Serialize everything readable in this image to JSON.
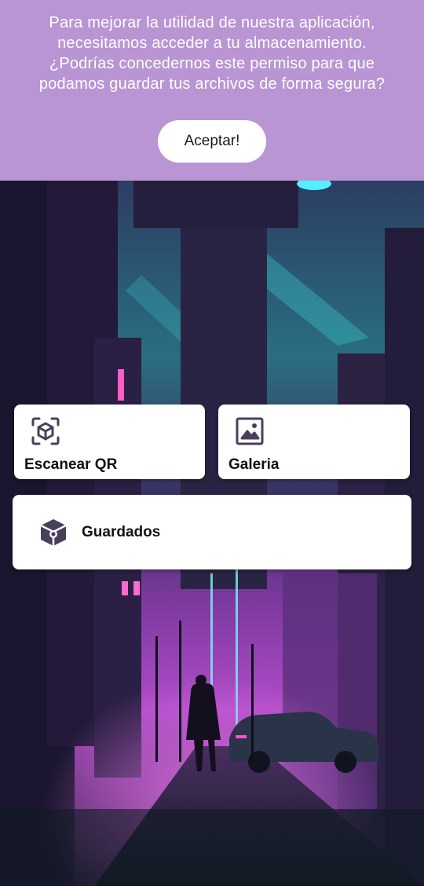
{
  "permission_banner": {
    "message_lines": [
      "Para mejorar la utilidad de nuestra aplicación,",
      "necesitamos acceder a tu almacenamiento.",
      "¿Podrías concedernos este permiso para que",
      "podamos guardar tus archivos de forma segura?"
    ],
    "accept_label": "Aceptar!",
    "background_color": "#b995d4"
  },
  "menu": {
    "scan_qr": {
      "label": "Escanear QR",
      "icon": "qr-scan-icon"
    },
    "gallery": {
      "label": "Galeria",
      "icon": "gallery-icon"
    },
    "saved": {
      "label": "Guardados",
      "icon": "saved-box-icon"
    }
  },
  "background": {
    "description_icon": "cyberpunk-city-illustration"
  },
  "colors": {
    "icon": "#4a3f58",
    "card": "#ffffff",
    "accent_neon_pink": "#d04fe0",
    "accent_neon_cyan": "#3fe0e0"
  }
}
